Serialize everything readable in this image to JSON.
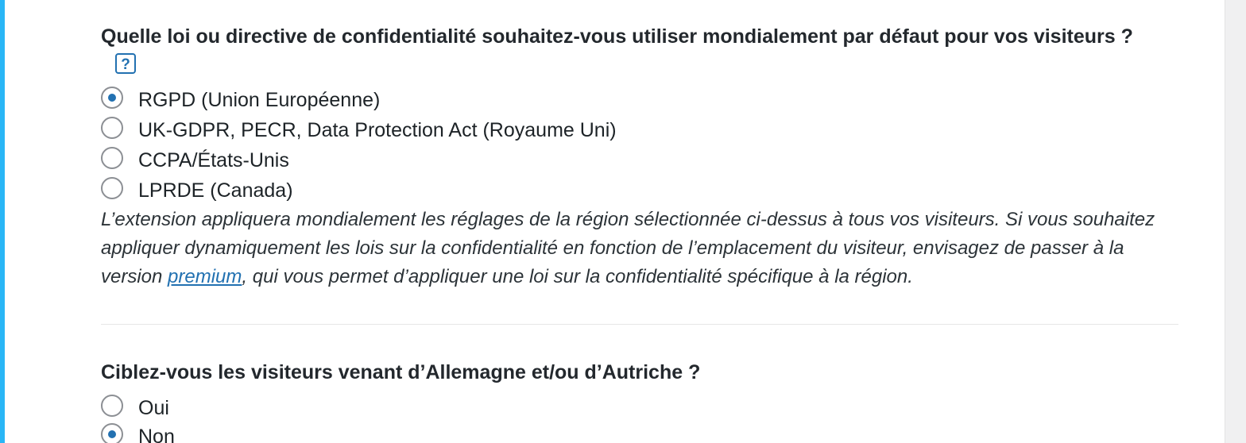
{
  "section1": {
    "question": "Quelle loi ou directive de confidentialité souhaitez-vous utiliser mondialement par défaut pour vos visiteurs ?",
    "help_label": "?",
    "options": [
      {
        "label": "RGPD (Union Européenne)",
        "checked": true
      },
      {
        "label": "UK-GDPR, PECR, Data Protection Act (Royaume Uni)",
        "checked": false
      },
      {
        "label": "CCPA/États-Unis",
        "checked": false
      },
      {
        "label": "LPRDE (Canada)",
        "checked": false
      }
    ],
    "note_before": "L’extension appliquera mondialement les réglages de la région sélectionnée ci-dessus à tous vos visiteurs. Si vous souhaitez appliquer dynamiquement les lois sur la confidentialité en fonction de l’emplacement du visiteur, envisagez de passer à la version ",
    "note_link": "premium",
    "note_after": ", qui vous permet d’appliquer une loi sur la confidentialité spécifique à la région."
  },
  "section2": {
    "question": "Ciblez-vous les visiteurs venant d’Allemagne et/ou d’Autriche ?",
    "options": [
      {
        "label": "Oui",
        "checked": false
      },
      {
        "label": "Non",
        "checked": true
      }
    ]
  },
  "colors": {
    "accent": "#2271b1",
    "left_border": "#29b6f6"
  }
}
